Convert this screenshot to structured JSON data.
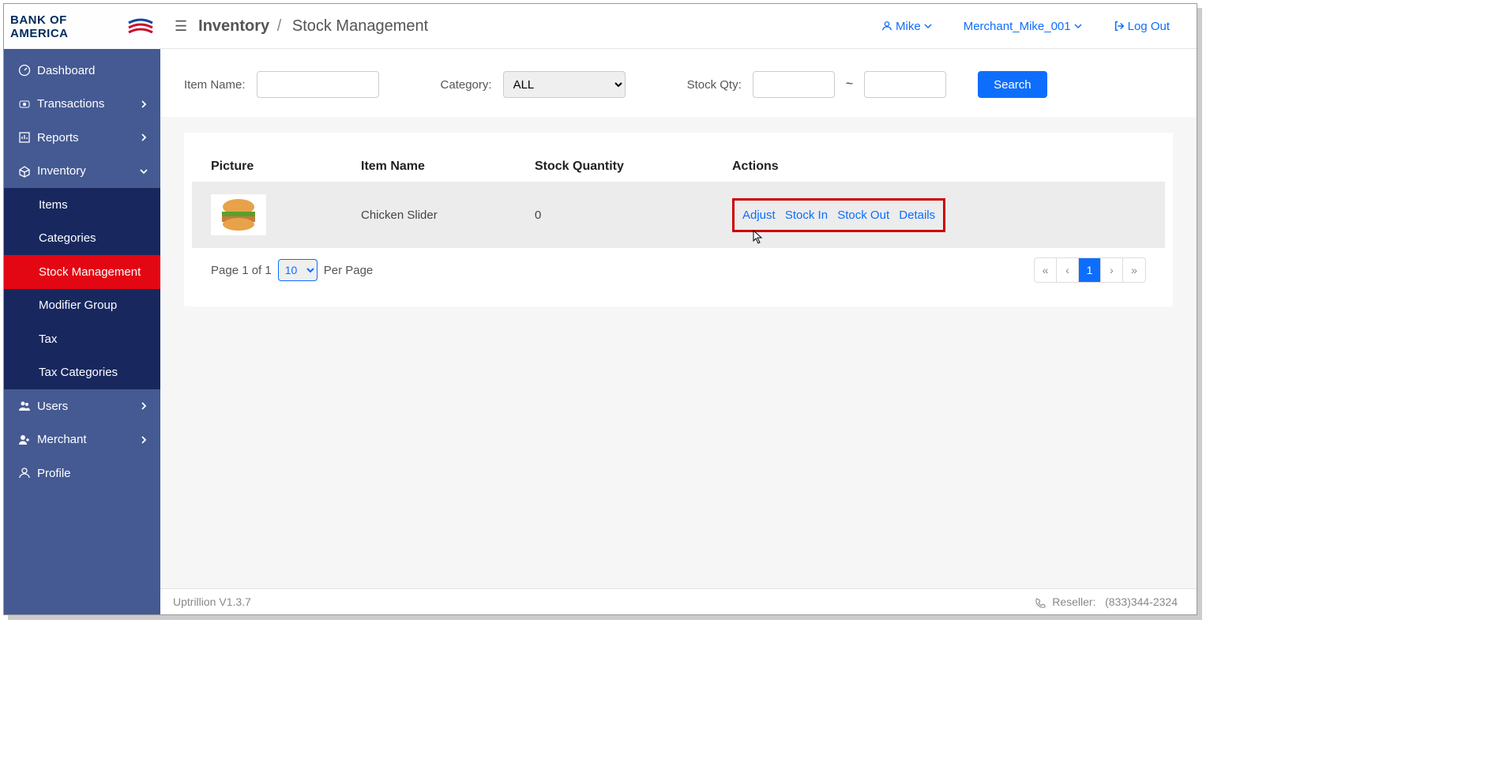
{
  "brand": "BANK OF AMERICA",
  "header": {
    "breadcrumb_root": "Inventory",
    "breadcrumb_current": "Stock Management",
    "user_name": "Mike",
    "merchant_name": "Merchant_Mike_001",
    "logout_label": "Log Out"
  },
  "sidebar": {
    "dashboard": "Dashboard",
    "transactions": "Transactions",
    "reports": "Reports",
    "inventory": "Inventory",
    "items": "Items",
    "categories": "Categories",
    "stock_management": "Stock Management",
    "modifier_group": "Modifier Group",
    "tax": "Tax",
    "tax_categories": "Tax Categories",
    "users": "Users",
    "merchant": "Merchant",
    "profile": "Profile"
  },
  "filters": {
    "item_name_label": "Item Name:",
    "category_label": "Category:",
    "category_value": "ALL",
    "stock_qty_label": "Stock Qty:",
    "range_sep": "~",
    "search_label": "Search"
  },
  "table": {
    "col_picture": "Picture",
    "col_item_name": "Item Name",
    "col_stock_qty": "Stock Quantity",
    "col_actions": "Actions",
    "rows": [
      {
        "item_name": "Chicken Slider",
        "stock_qty": "0"
      }
    ],
    "actions": {
      "adjust": "Adjust",
      "stock_in": "Stock In",
      "stock_out": "Stock Out",
      "details": "Details"
    }
  },
  "pagination": {
    "page_text_prefix": "Page 1 of 1",
    "per_page_text": "Per Page",
    "per_page_value": "10",
    "current_page": "1"
  },
  "footer": {
    "version": "Uptrillion V1.3.7",
    "reseller_label": "Reseller:",
    "reseller_phone": "(833)344-2324"
  }
}
